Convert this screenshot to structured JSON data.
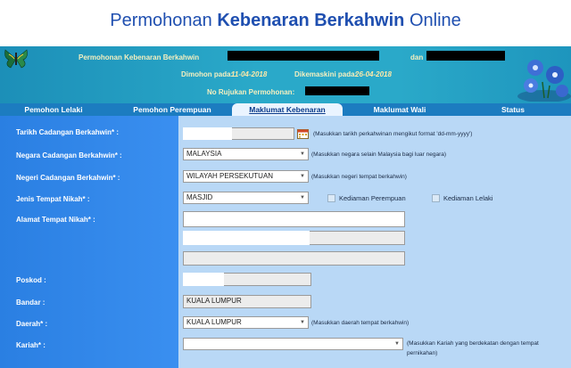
{
  "banner": {
    "title_pre": "Permohonan ",
    "title_bold": "Kebenaran Berkahwin",
    "title_post": " Online"
  },
  "header": {
    "line1_prefix": "Permohonan Kebenaran Berkahwin",
    "line1_and": "dan",
    "dimohon_label": "Dimohon pada:",
    "dimohon_value": "11-04-2018",
    "dikemaskini_label": "Dikemaskini pada:",
    "dikemaskini_value": "26-04-2018",
    "rujukan_label": "No Rujukan Permohonan:"
  },
  "tabs": [
    "Pemohon Lelaki",
    "Pemohon Perempuan",
    "Maklumat Kebenaran",
    "Maklumat Wali",
    "Status"
  ],
  "active_tab": "Maklumat Kebenaran",
  "form": {
    "tarikh_label": "Tarikh Cadangan Berkahwin* :",
    "tarikh_hint": "(Masukkan tarikh perkahwinan mengikut format 'dd-mm-yyyy')",
    "negara_label": "Negara Cadangan Berkahwin* :",
    "negara_value": "MALAYSIA",
    "negara_hint": "(Masukkan negara selain Malaysia bagi luar negara)",
    "negeri_label": "Negeri Cadangan Berkahwin* :",
    "negeri_value": "WILAYAH PERSEKUTUAN",
    "negeri_hint": "(Masukkan negeri tempat berkahwin)",
    "jenis_label": "Jenis Tempat Nikah* :",
    "jenis_value": "MASJID",
    "kediaman_perempuan": "Kediaman Perempuan",
    "kediaman_lelaki": "Kediaman Lelaki",
    "alamat_label": "Alamat Tempat Nikah* :",
    "poskod_label": "Poskod :",
    "bandar_label": "Bandar :",
    "bandar_value": "KUALA LUMPUR",
    "daerah_label": "Daerah* :",
    "daerah_value": "KUALA LUMPUR",
    "daerah_hint": "(Masukkan daerah tempat berkahwin)",
    "kariah_label": "Kariah* :",
    "kariah_hint_1": "(Masukkan Kariah yang berdekatan dengan tempat",
    "kariah_hint_2": "pernikahan)"
  }
}
